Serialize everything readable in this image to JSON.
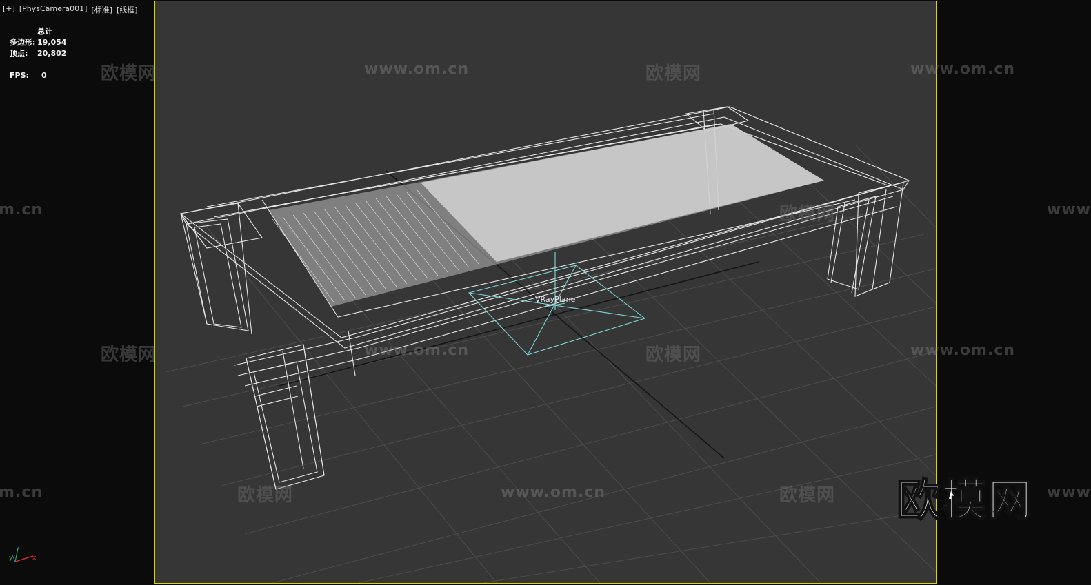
{
  "viewport": {
    "labels": [
      "[+]",
      "[PhysCamera001]",
      "[标准]",
      "[线框]"
    ],
    "border_color": "#e0d400",
    "background": "#363636"
  },
  "stats": {
    "header": "总计",
    "polygons_label": "多边形:",
    "polygons_value": "19,054",
    "vertices_label": "顶点:",
    "vertices_value": "20,802",
    "fps_label": "FPS:",
    "fps_value": "0"
  },
  "scene": {
    "object_label": "VRayPlane",
    "object_color": "#7fd6d6",
    "wireframe_color": "#e8e8e8"
  },
  "axis_gizmo": {
    "x": "x",
    "y": "y",
    "z": "z"
  },
  "watermarks": {
    "cn": "欧模网",
    "url": "www.om.cn"
  },
  "brand_logo": "欧模网"
}
